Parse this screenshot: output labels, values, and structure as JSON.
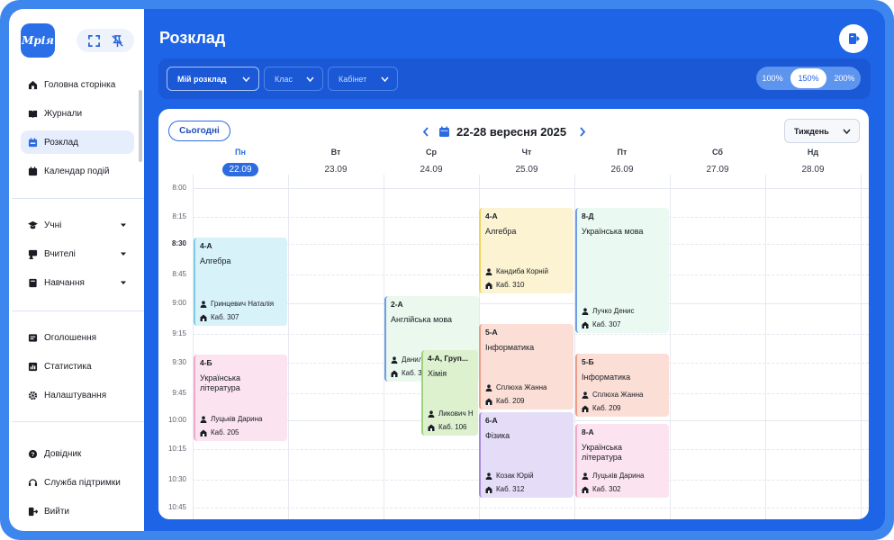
{
  "app": {
    "logo_text": "Мрія"
  },
  "sidebar": {
    "group1": [
      {
        "label": "Головна сторінка",
        "icon": "home-icon"
      },
      {
        "label": "Журнали",
        "icon": "journal-icon"
      },
      {
        "label": "Розклад",
        "icon": "schedule-icon",
        "active": true
      },
      {
        "label": "Календар подій",
        "icon": "calendar-icon"
      }
    ],
    "group2": [
      {
        "label": "Учні",
        "icon": "student-icon"
      },
      {
        "label": "Вчителі",
        "icon": "teacher-icon"
      },
      {
        "label": "Навчання",
        "icon": "book-icon"
      }
    ],
    "group3": [
      {
        "label": "Оголошення",
        "icon": "announcement-icon"
      },
      {
        "label": "Статистика",
        "icon": "stats-icon"
      },
      {
        "label": "Налаштування",
        "icon": "gear-icon"
      }
    ],
    "group4": [
      {
        "label": "Довідник",
        "icon": "help-icon"
      },
      {
        "label": "Служба підтримки",
        "icon": "support-icon"
      },
      {
        "label": "Вийти",
        "icon": "logout-icon"
      }
    ]
  },
  "header": {
    "title": "Розклад"
  },
  "filters": {
    "my_schedule": "Мій розклад",
    "class": "Клас",
    "room": "Кабінет",
    "zoom_options": [
      "100%",
      "150%",
      "200%"
    ],
    "zoom_selected": "150%"
  },
  "calendar": {
    "today_label": "Сьогодні",
    "range": "22-28 вересня 2025",
    "view": "Тиждень",
    "days": [
      {
        "name": "Пн",
        "date": "22.09",
        "today": true
      },
      {
        "name": "Вт",
        "date": "23.09"
      },
      {
        "name": "Ср",
        "date": "24.09"
      },
      {
        "name": "Чт",
        "date": "25.09"
      },
      {
        "name": "Пт",
        "date": "26.09"
      },
      {
        "name": "Сб",
        "date": "27.09"
      },
      {
        "name": "Нд",
        "date": "28.09"
      }
    ],
    "times": [
      "8:00",
      "8:15",
      "8:30",
      "8:45",
      "9:00",
      "9:15",
      "9:30",
      "9:45",
      "10:00",
      "10:15",
      "10:30",
      "10:45"
    ],
    "events": [
      {
        "group": "4-А",
        "subject": "Алгебра",
        "teacher": "Гринцевич Наталія",
        "room": "Каб. 307",
        "color": "#d8f2f9",
        "border": "#7fcbe6"
      },
      {
        "group": "4-Б",
        "subject": "Українська література",
        "teacher": "Луцьків Дарина",
        "room": "Каб. 205",
        "color": "#fbe3ef",
        "border": "#f2a9c9"
      },
      {
        "group": "2-А",
        "subject": "Англійська мова",
        "teacher": "Данил",
        "room": "Каб. 3",
        "color": "#eaf8ee",
        "border": "#6f9ee6"
      },
      {
        "group": "4-А, Груп...",
        "subject": "Хімія",
        "teacher": "Ликович Н",
        "room": "Каб. 106",
        "color": "#ddf1cf",
        "border": "#9fd27c"
      },
      {
        "group": "4-А",
        "subject": "Алгебра",
        "teacher": "Кандиба Корній",
        "room": "Каб. 310",
        "color": "#fbf3d2",
        "border": "#f0d35a"
      },
      {
        "group": "5-А",
        "subject": "Інформатика",
        "teacher": "Сплюха Жанна",
        "room": "Каб. 209",
        "color": "#fbded6",
        "border": "#f19b86"
      },
      {
        "group": "6-А",
        "subject": "Фізика",
        "teacher": "Козак Юрій",
        "room": "Каб. 312",
        "color": "#e5ddf7",
        "border": "#a68ae0"
      },
      {
        "group": "8-Д",
        "subject": "Українська мова",
        "teacher": "Лучко Денис",
        "room": "Каб. 307",
        "color": "#eaf9f1",
        "border": "#6f9ee6"
      },
      {
        "group": "5-Б",
        "subject": "Інформатика",
        "teacher": "Сплюха Жанна",
        "room": "Каб. 209",
        "color": "#fbded6",
        "border": "#f19b86"
      },
      {
        "group": "8-А",
        "subject": "Українська література",
        "teacher": "Луцьків Дарина",
        "room": "Каб. 302",
        "color": "#fbe3ef",
        "border": "#f2a9c9"
      }
    ]
  }
}
